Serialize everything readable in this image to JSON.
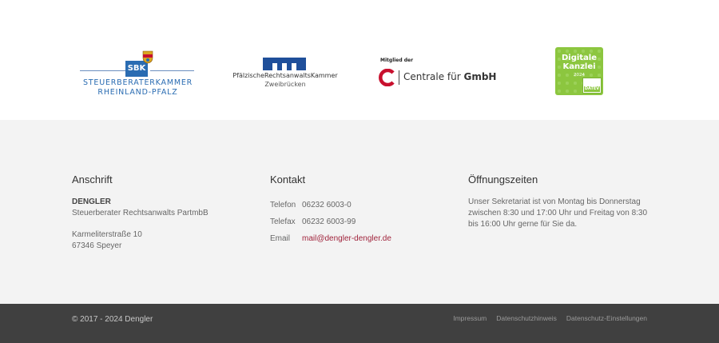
{
  "logos": {
    "sbk": {
      "abbr": "SBK",
      "line1": "STEUERBERATERKAMMER",
      "line2": "RHEINLAND-PFALZ",
      "color": "#2a6cb2"
    },
    "prak": {
      "line1": "PfälzischeRechtsanwaltsKammer",
      "line2": "Zweibrücken",
      "color": "#1f4f9a"
    },
    "centrale": {
      "member_label": "Mitglied der",
      "name_regular": "Centrale für ",
      "name_bold": "GmbH",
      "color": "#c8102e"
    },
    "digitale_kanzlei": {
      "line1": "Digitale",
      "line2": "Kanzlei",
      "year": "2024",
      "badge": "DATEV",
      "color": "#8cc63f"
    }
  },
  "footer": {
    "anschrift": {
      "heading": "Anschrift",
      "company": "DENGLER",
      "subtitle": "Steuerberater Rechtsanwalts PartmbB",
      "street": "Karmeliterstraße 10",
      "city": "67346 Speyer"
    },
    "kontakt": {
      "heading": "Kontakt",
      "rows": [
        {
          "label": "Telefon",
          "value": "06232 6003-0"
        },
        {
          "label": "Telefax",
          "value": "06232 6003-99"
        },
        {
          "label": "Email",
          "value": "mail@dengler-dengler.de"
        }
      ]
    },
    "oeffnungszeiten": {
      "heading": "Öffnungszeiten",
      "text": "Unser Sekretariat ist von Montag bis Donnerstag zwischen 8:30 und 17:00 Uhr und Freitag von 8:30 bis 16:00 Uhr gerne für Sie da."
    }
  },
  "bottom": {
    "copyright": "© 2017 - 2024 Dengler",
    "links": [
      "Impressum",
      "Datenschutzhinweis",
      "Datenschutz-Einstellungen"
    ]
  }
}
